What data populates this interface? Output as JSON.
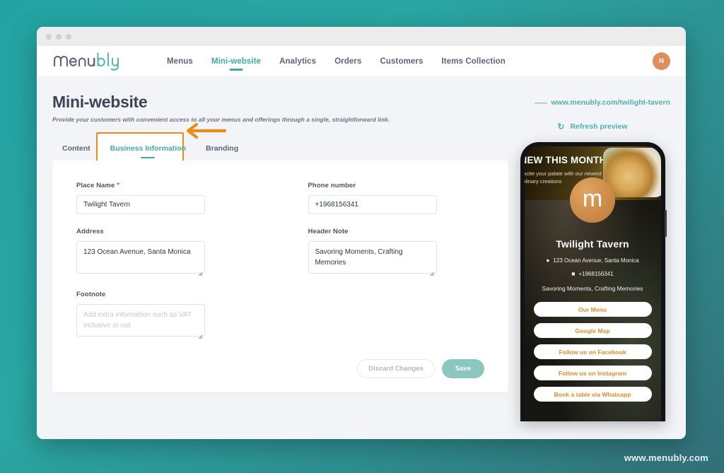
{
  "window": {
    "dots": [
      "close",
      "minimize",
      "maximize"
    ]
  },
  "nav": {
    "brand": "menubly",
    "links": [
      {
        "label": "Menus",
        "active": false
      },
      {
        "label": "Mini-website",
        "active": true
      },
      {
        "label": "Analytics",
        "active": false
      },
      {
        "label": "Orders",
        "active": false
      },
      {
        "label": "Customers",
        "active": false
      },
      {
        "label": "Items Collection",
        "active": false
      }
    ],
    "avatar_initial": "N"
  },
  "page": {
    "title": "Mini-website",
    "subtitle": "Provide your customers with convenient access to all your menus and offerings through a single, straightforward link.",
    "site_link": "www.menubly.com/twilight-tavern",
    "site_link_icon": "link-icon"
  },
  "tabs": [
    {
      "label": "Content",
      "active": false
    },
    {
      "label": "Business Information",
      "active": true
    },
    {
      "label": "Branding",
      "active": false
    }
  ],
  "annotation": {
    "arrow_color": "#ef8a17",
    "highlight_color": "#ef8a17"
  },
  "form": {
    "fields": {
      "place_name": {
        "label": "Place Name",
        "required_mark": "*",
        "value": "Twilight Tavern",
        "placeholder": ""
      },
      "address": {
        "label": "Address",
        "value": "123 Ocean Avenue, Santa Monica",
        "placeholder": ""
      },
      "footnote": {
        "label": "Footnote",
        "value": "",
        "placeholder": "Add extra information such as VAT inclusive or not"
      },
      "phone_number": {
        "label": "Phone number",
        "value": "+1968156341",
        "placeholder": ""
      },
      "header_note": {
        "label": "Header Note",
        "value": "Savoring Moments, Crafting Memories",
        "placeholder": ""
      }
    },
    "discard_label": "Discard Changes",
    "save_label": "Save"
  },
  "preview": {
    "refresh_label": "Refresh preview",
    "refresh_icon": "refresh-icon",
    "banner": {
      "title": "NEW THIS MONTH",
      "subtitle": "Excite your palate with our newest culinary creations"
    },
    "logo_letter": "m",
    "business_name": "Twilight Tavern",
    "address": "123 Ocean Avenue, Santa Monica",
    "address_icon": "location-pin-icon",
    "phone": "+1968156341",
    "phone_icon": "phone-icon",
    "header_note": "Savoring Moments, Crafting Memories",
    "links": [
      {
        "label": "Our Menu"
      },
      {
        "label": "Google Map"
      },
      {
        "label": "Follow us on Facebook"
      },
      {
        "label": "Follow us on Instagram"
      },
      {
        "label": "Book a table via Whatsapp"
      }
    ]
  },
  "watermark": "www.menubly.com",
  "colors": {
    "accent_teal": "#3eaaa5",
    "accent_orange": "#ef8a17",
    "save_button": "#8cc6c0",
    "avatar": "#dd8f5e",
    "link_orange": "#d98e28",
    "required": "#ef5565"
  }
}
